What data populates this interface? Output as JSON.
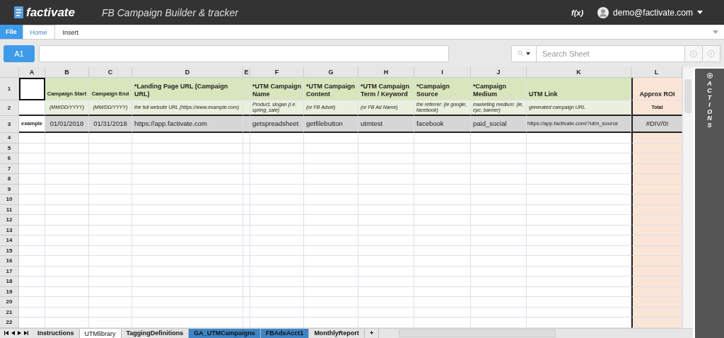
{
  "header": {
    "logo": "factivate",
    "title": "FB Campaign Builder & tracker",
    "formula_toggle": "f(x)",
    "user": "demo@factivate.com"
  },
  "file_button": "File",
  "menu_tabs": [
    {
      "label": "Home",
      "selected": true
    },
    {
      "label": "Insert",
      "selected": false
    }
  ],
  "formula_bar": {
    "cell_ref": "A1",
    "search_placeholder": "Search Sheet"
  },
  "sheet": {
    "columns": [
      "A",
      "B",
      "C",
      "D",
      "E",
      "F",
      "G",
      "H",
      "I",
      "J",
      "K",
      "L"
    ],
    "rows": [
      {
        "number": "1",
        "kind": "heading",
        "cells": {
          "B": "Campaign Start",
          "C": "Campaign End",
          "D": "*Landing Page URL (Campaign URL)",
          "F": "*UTM Campaign Name",
          "G": "*UTM Campaign Content",
          "H": "*UTM Campaign Term / Keyword",
          "I": "*Campaign Source",
          "J": "*Campaign Medium",
          "K": "UTM Link",
          "L": "Approx ROI"
        }
      },
      {
        "number": "2",
        "kind": "hint",
        "cells": {
          "B": "(MM/DD/YYYY)",
          "C": "(MM/DD/YYYY)",
          "D": "the full website URL (https://www.example.com)",
          "F": "Product, slogan (i.e. spring_sale)",
          "G": "(or FB Adset)",
          "H": "(or FB Ad Name)",
          "I": "the referrer: (ie google, facebook)",
          "J": "marketing medium: (ie, cpc, banner)",
          "K": "generated campaign URL",
          "L": "Total"
        }
      },
      {
        "number": "3",
        "kind": "data",
        "cells": {
          "A": "example",
          "B": "01/01/2018",
          "C": "01/31/2018",
          "D": "https://app.factivate.com",
          "F": "getspreadsheet",
          "G": "getfilebutton",
          "H": "utmtest",
          "I": "facebook",
          "J": "paid_social",
          "K": "https://app.factivate.com/?utm_source",
          "L": "#DIV/0!"
        }
      },
      {
        "number": "4",
        "kind": "empty"
      },
      {
        "number": "5",
        "kind": "empty"
      },
      {
        "number": "6",
        "kind": "empty"
      },
      {
        "number": "7",
        "kind": "empty"
      },
      {
        "number": "8",
        "kind": "empty"
      },
      {
        "number": "9",
        "kind": "empty"
      },
      {
        "number": "10",
        "kind": "empty"
      },
      {
        "number": "11",
        "kind": "empty"
      },
      {
        "number": "12",
        "kind": "empty"
      },
      {
        "number": "13",
        "kind": "empty"
      },
      {
        "number": "14",
        "kind": "empty"
      },
      {
        "number": "15",
        "kind": "empty"
      },
      {
        "number": "16",
        "kind": "empty"
      },
      {
        "number": "17",
        "kind": "empty"
      },
      {
        "number": "18",
        "kind": "empty"
      },
      {
        "number": "19",
        "kind": "empty"
      },
      {
        "number": "20",
        "kind": "empty"
      },
      {
        "number": "21",
        "kind": "empty"
      },
      {
        "number": "22",
        "kind": "empty"
      }
    ]
  },
  "sheet_tabs": [
    {
      "label": "Instructions",
      "selected": false,
      "color": "#e4e4e4"
    },
    {
      "label": "UTMlibrary",
      "selected": true,
      "color": "#ffffff"
    },
    {
      "label": "TaggingDefinitions",
      "selected": false,
      "color": "#e4e4e4"
    },
    {
      "label": "GA_UTMCampaigns",
      "selected": false,
      "color": "#3d85c6"
    },
    {
      "label": "FBAdsAcct1",
      "selected": false,
      "color": "#3d85c6"
    },
    {
      "label": "MonthlyReport",
      "selected": false,
      "color": "#e4e4e4"
    }
  ],
  "add_sheet": "+",
  "actions_panel": "ACTIONS"
}
